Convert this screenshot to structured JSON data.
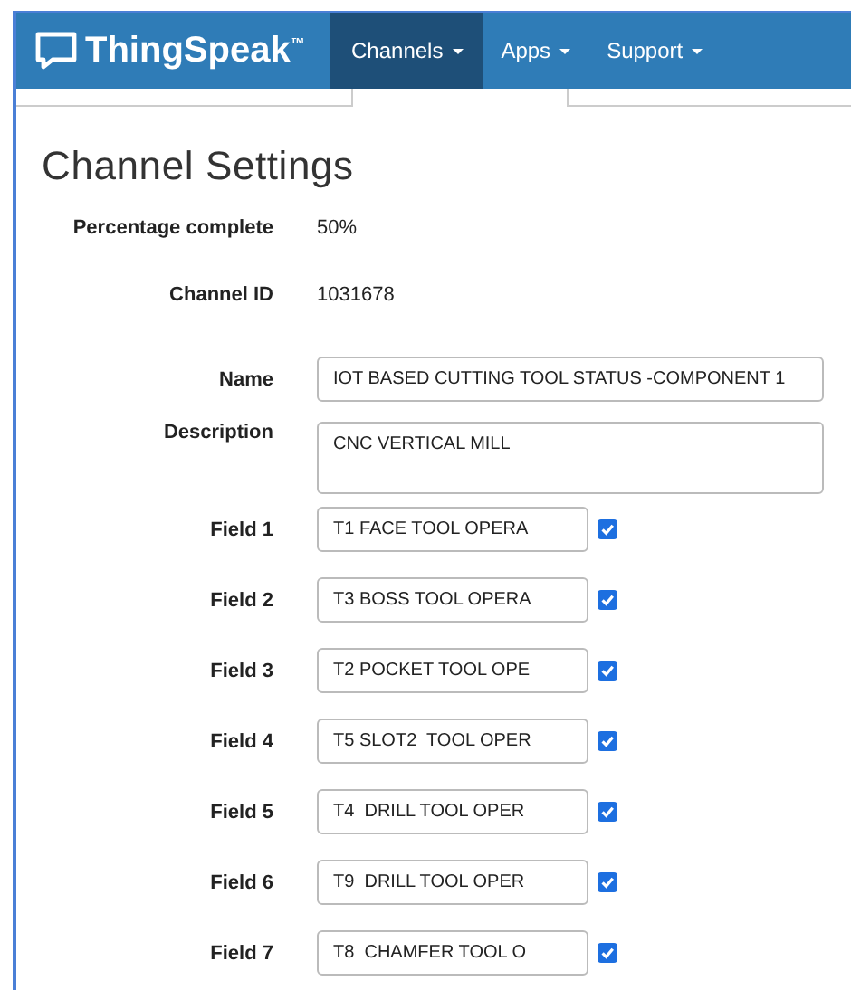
{
  "navbar": {
    "brand": "ThingSpeak$^{™}$",
    "items": [
      {
        "label": "Channels",
        "selected": true
      },
      {
        "label": "Apps",
        "selected": false
      },
      {
        "label": "Support",
        "selected": false
      }
    ]
  },
  "page": {
    "title": "Channel Settings",
    "info": [
      {
        "label": "Percentage complete",
        "value": "50%"
      },
      {
        "label": "Channel ID",
        "value": "1031678"
      }
    ],
    "name": {
      "label": "Name",
      "value": "IOT BASED CUTTING TOOL STATUS -COMPONENT 1"
    },
    "description": {
      "label": "Description",
      "value": "CNC VERTICAL MILL"
    },
    "fields": [
      {
        "label": "Field 1",
        "value": "T1 FACE TOOL OPERA",
        "checked": true
      },
      {
        "label": "Field 2",
        "value": "T3 BOSS TOOL OPERA",
        "checked": true
      },
      {
        "label": "Field 3",
        "value": "T2 POCKET TOOL OPE",
        "checked": true
      },
      {
        "label": "Field 4",
        "value": "T5 SLOT2  TOOL OPER",
        "checked": true
      },
      {
        "label": "Field 5",
        "value": "T4  DRILL TOOL OPER",
        "checked": true
      },
      {
        "label": "Field 6",
        "value": "T9  DRILL TOOL OPER",
        "checked": true
      },
      {
        "label": "Field 7",
        "value": "T8  CHAMFER TOOL O",
        "checked": true
      }
    ]
  }
}
